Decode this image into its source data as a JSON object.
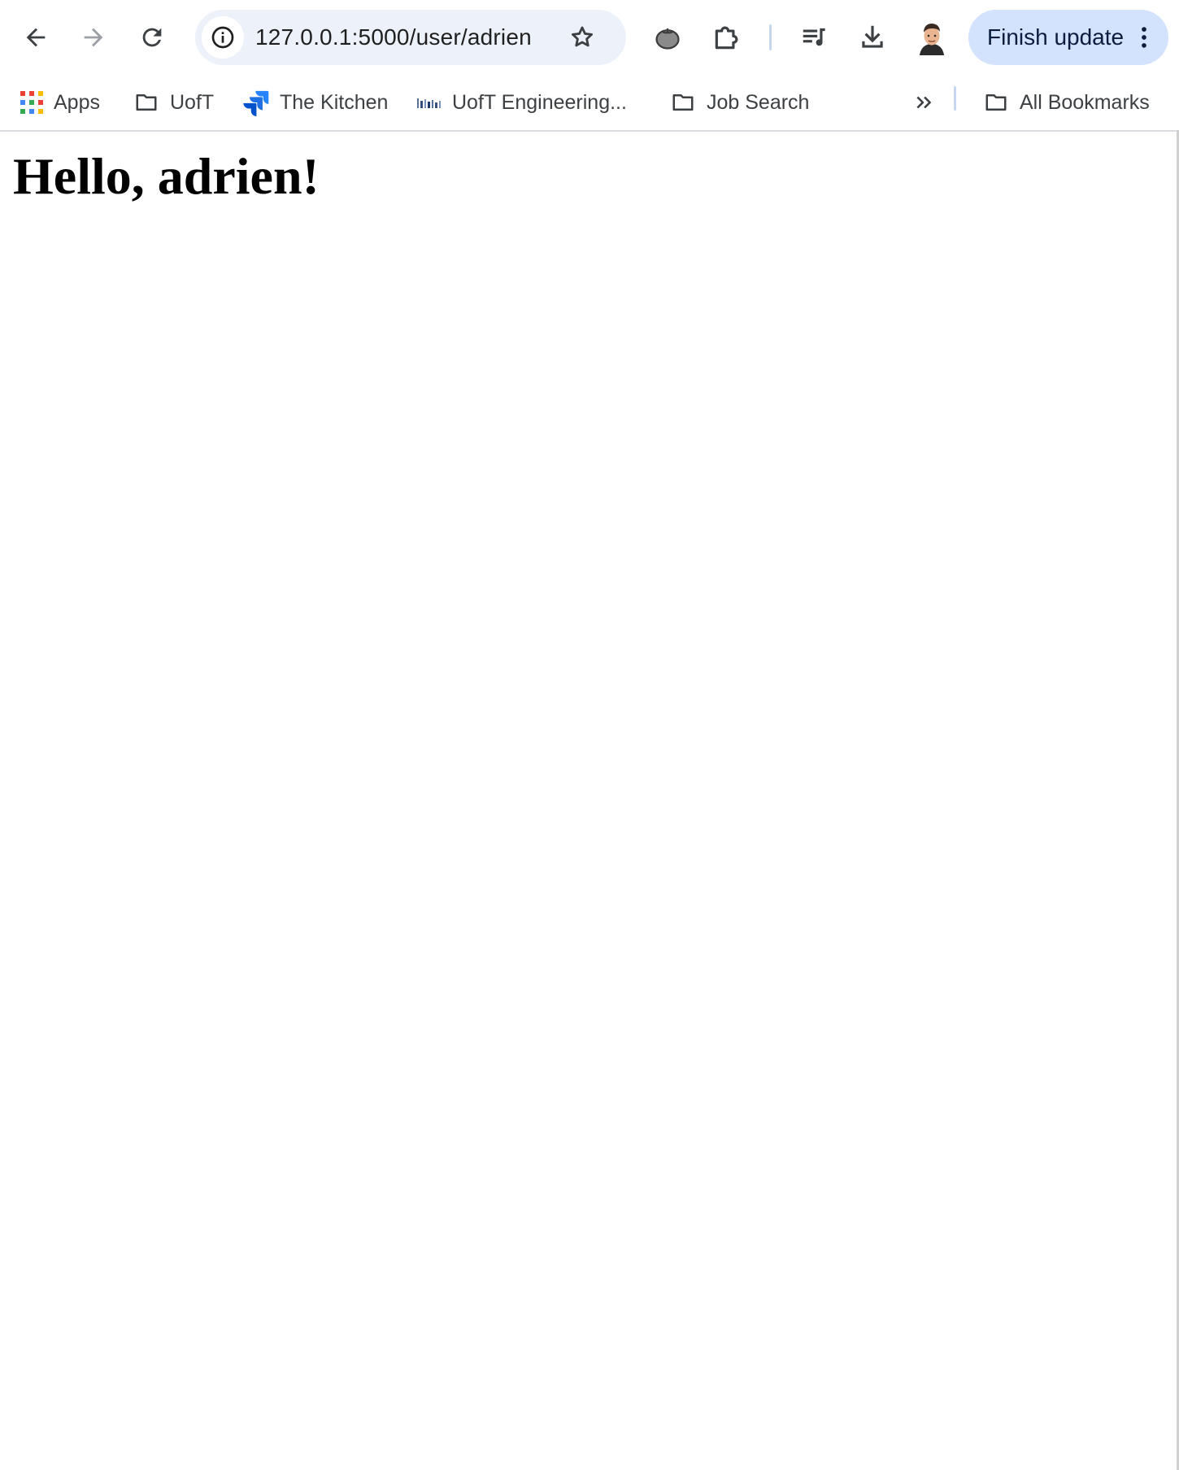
{
  "browser": {
    "url": "127.0.0.1:5000/user/adrien",
    "update_button_label": "Finish update",
    "nav_icons": [
      "back-arrow-icon",
      "forward-arrow-icon",
      "reload-icon"
    ],
    "toolbar_icons": [
      "tomato-extension-icon",
      "puzzle-extension-icon",
      "media-queue-icon",
      "download-icon"
    ]
  },
  "bookmarks": {
    "items": [
      {
        "label": "Apps",
        "icon": "apps-grid-icon"
      },
      {
        "label": "UofT",
        "icon": "folder-icon"
      },
      {
        "label": "The Kitchen",
        "icon": "jira-logo-icon"
      },
      {
        "label": "UofT Engineering...",
        "icon": "site-favicon-icon"
      },
      {
        "label": "Job Search",
        "icon": "folder-icon"
      }
    ],
    "all_bookmarks_label": "All Bookmarks"
  },
  "page": {
    "heading": "Hello, adrien!"
  },
  "colors": {
    "omnibox_bg": "#edf2fa",
    "update_button_bg": "#d3e3fd",
    "jira_blue": "#2684ff"
  }
}
